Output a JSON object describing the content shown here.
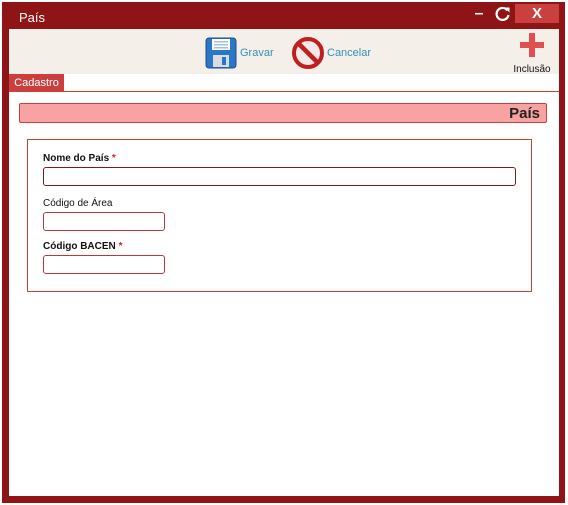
{
  "window": {
    "title": "País"
  },
  "titlebar": {
    "minimize_glyph": "–",
    "close_glyph": "X"
  },
  "toolbar": {
    "save_label": "Gravar",
    "cancel_label": "Cancelar",
    "add_label": "Inclusão",
    "save_icon": "floppy-disk-icon",
    "cancel_icon": "no-entry-icon",
    "add_icon": "plus-icon"
  },
  "tabs": [
    {
      "label": "Cadastro",
      "active": true
    }
  ],
  "section": {
    "title": "País"
  },
  "form": {
    "fields": [
      {
        "label": "Nome do País",
        "required": true,
        "value": ""
      },
      {
        "label": "Código de Área",
        "required": false,
        "value": ""
      },
      {
        "label": "Código BACEN",
        "required": true,
        "value": ""
      }
    ],
    "required_marker": "*"
  },
  "colors": {
    "frame": "#8e1416",
    "accent": "#c9403e",
    "header_fill": "#f9a2a2",
    "link": "#2f93b7"
  }
}
